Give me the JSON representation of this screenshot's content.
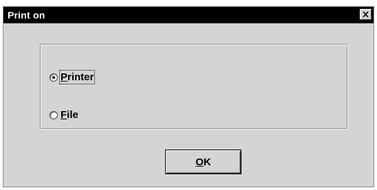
{
  "window": {
    "title": "Print on"
  },
  "options": [
    {
      "id": "printer",
      "accel": "P",
      "rest": "rinter",
      "selected": true
    },
    {
      "id": "file",
      "accel": "F",
      "rest": "ile",
      "selected": false
    }
  ],
  "buttons": {
    "ok": {
      "accel": "O",
      "rest": "K"
    }
  },
  "icons": {
    "close": "close-icon"
  }
}
